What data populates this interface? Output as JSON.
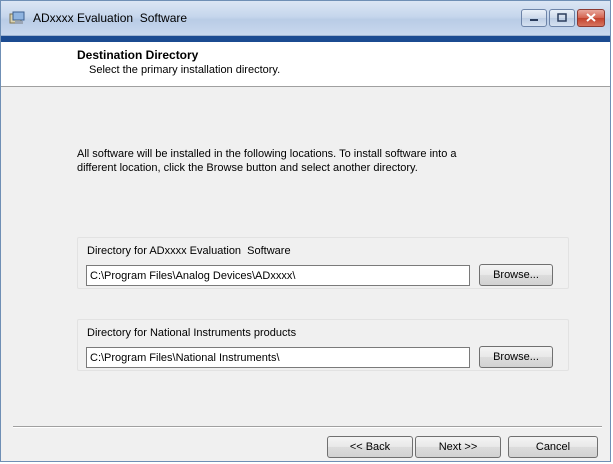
{
  "window": {
    "title": "ADxxxx Evaluation  Software"
  },
  "header": {
    "title": "Destination Directory",
    "subtitle": "Select the primary installation directory."
  },
  "info": {
    "text": "All software will be installed in the following locations. To install software into a different location, click the Browse button and select another directory."
  },
  "groups": [
    {
      "label": "Directory for ADxxxx Evaluation  Software",
      "path": "C:\\Program Files\\Analog Devices\\ADxxxx\\",
      "browse_label": "Browse..."
    },
    {
      "label": "Directory for National Instruments products",
      "path": "C:\\Program Files\\National Instruments\\",
      "browse_label": "Browse..."
    }
  ],
  "footer": {
    "back_label": "<< Back",
    "next_label": "Next >>",
    "cancel_label": "Cancel"
  },
  "icons": {
    "app": "installer-app-icon",
    "minimize": "minimize-icon",
    "maximize": "maximize-icon",
    "close": "close-icon"
  },
  "colors": {
    "header_accent": "#1b4b91",
    "close_button": "#c2412c"
  }
}
